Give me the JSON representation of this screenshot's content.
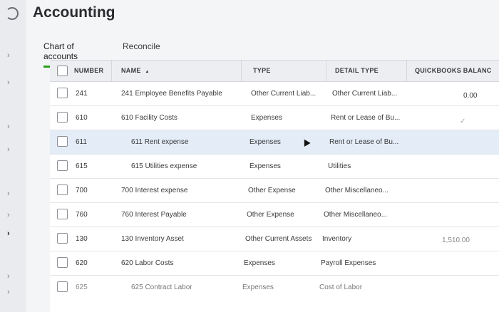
{
  "page": {
    "title": "Accounting"
  },
  "tabs": [
    {
      "label": "Chart of accounts",
      "active": true
    },
    {
      "label": "Reconcile",
      "active": false
    }
  ],
  "columns": {
    "number": "NUMBER",
    "name": "NAME",
    "type": "TYPE",
    "detail_type": "DETAIL TYPE",
    "balance": "QUICKBOOKS BALANC"
  },
  "sort_indicator": "▲",
  "rows": [
    {
      "number": "241",
      "name": "241 Employee Benefits Payable",
      "type": "Other Current Liab...",
      "detail": "Other Current Liab...",
      "balance": "0.00"
    },
    {
      "number": "610",
      "name": "610 Facility Costs",
      "type": "Expenses",
      "detail": "Rent or Lease of Bu...",
      "balance": ""
    },
    {
      "number": "611",
      "name": "611 Rent expense",
      "type": "Expenses",
      "detail": "Rent or Lease of Bu...",
      "balance": ""
    },
    {
      "number": "615",
      "name": "615 Utilities expense",
      "type": "Expenses",
      "detail": "Utilities",
      "balance": ""
    },
    {
      "number": "700",
      "name": "700 Interest expense",
      "type": "Other Expense",
      "detail": "Other Miscellaneo...",
      "balance": ""
    },
    {
      "number": "760",
      "name": "760 Interest Payable",
      "type": "Other Expense",
      "detail": "Other Miscellaneo...",
      "balance": ""
    },
    {
      "number": "130",
      "name": "130 Inventory Asset",
      "type": "Other Current Assets",
      "detail": "Inventory",
      "balance": "1,510.00"
    },
    {
      "number": "620",
      "name": "620 Labor Costs",
      "type": "Expenses",
      "detail": "Payroll Expenses",
      "balance": ""
    },
    {
      "number": "625",
      "name": "625 Contract Labor",
      "type": "Expenses",
      "detail": "Cost of Labor",
      "balance": ""
    }
  ],
  "highlighted_row": 2,
  "icons": {
    "nav": "chevron-right-icon",
    "cursor": "mouse-pointer-icon",
    "check": "checkmark-icon"
  },
  "colors": {
    "accent": "#2ca01c",
    "highlight": "#e4ecf7"
  }
}
